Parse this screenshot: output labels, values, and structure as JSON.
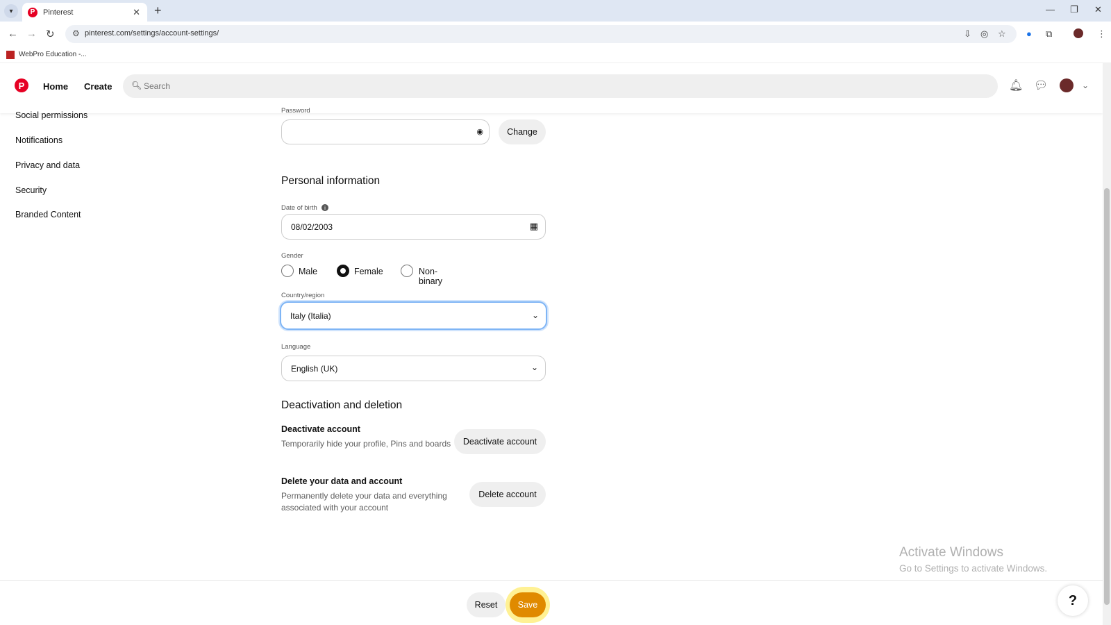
{
  "browser": {
    "tab_title": "Pinterest",
    "tab_favicon": "P",
    "url": "pinterest.com/settings/account-settings/",
    "bookmark": "WebPro Education -..."
  },
  "header": {
    "logo": "P",
    "nav": [
      "Home",
      "Create"
    ],
    "search_placeholder": "Search"
  },
  "sidebar": {
    "items": [
      "Social permissions",
      "Notifications",
      "Privacy and data",
      "Security",
      "Branded Content"
    ]
  },
  "password": {
    "label": "Password",
    "change_button": "Change"
  },
  "personal": {
    "heading": "Personal information",
    "dob_label": "Date of birth",
    "dob_value": "08/02/2003",
    "gender_label": "Gender",
    "gender_options": [
      "Male",
      "Female",
      "Non-binary"
    ],
    "gender_selected": "Female",
    "country_label": "Country/region",
    "country_value": "Italy (Italia)",
    "language_label": "Language",
    "language_value": "English (UK)"
  },
  "deactivation": {
    "heading": "Deactivation and deletion",
    "deactivate_title": "Deactivate account",
    "deactivate_desc": "Temporarily hide your profile, Pins and boards",
    "deactivate_button": "Deactivate account",
    "delete_title": "Delete your data and account",
    "delete_desc": "Permanently delete your data and everything associated with your account",
    "delete_button": "Delete account"
  },
  "footer": {
    "reset": "Reset",
    "save": "Save",
    "help": "?"
  },
  "watermark": {
    "line1": "Activate Windows",
    "line2": "Go to Settings to activate Windows."
  },
  "colors": {
    "brand": "#e60023",
    "save": "#e08a00",
    "focus": "#7fb5f5"
  }
}
